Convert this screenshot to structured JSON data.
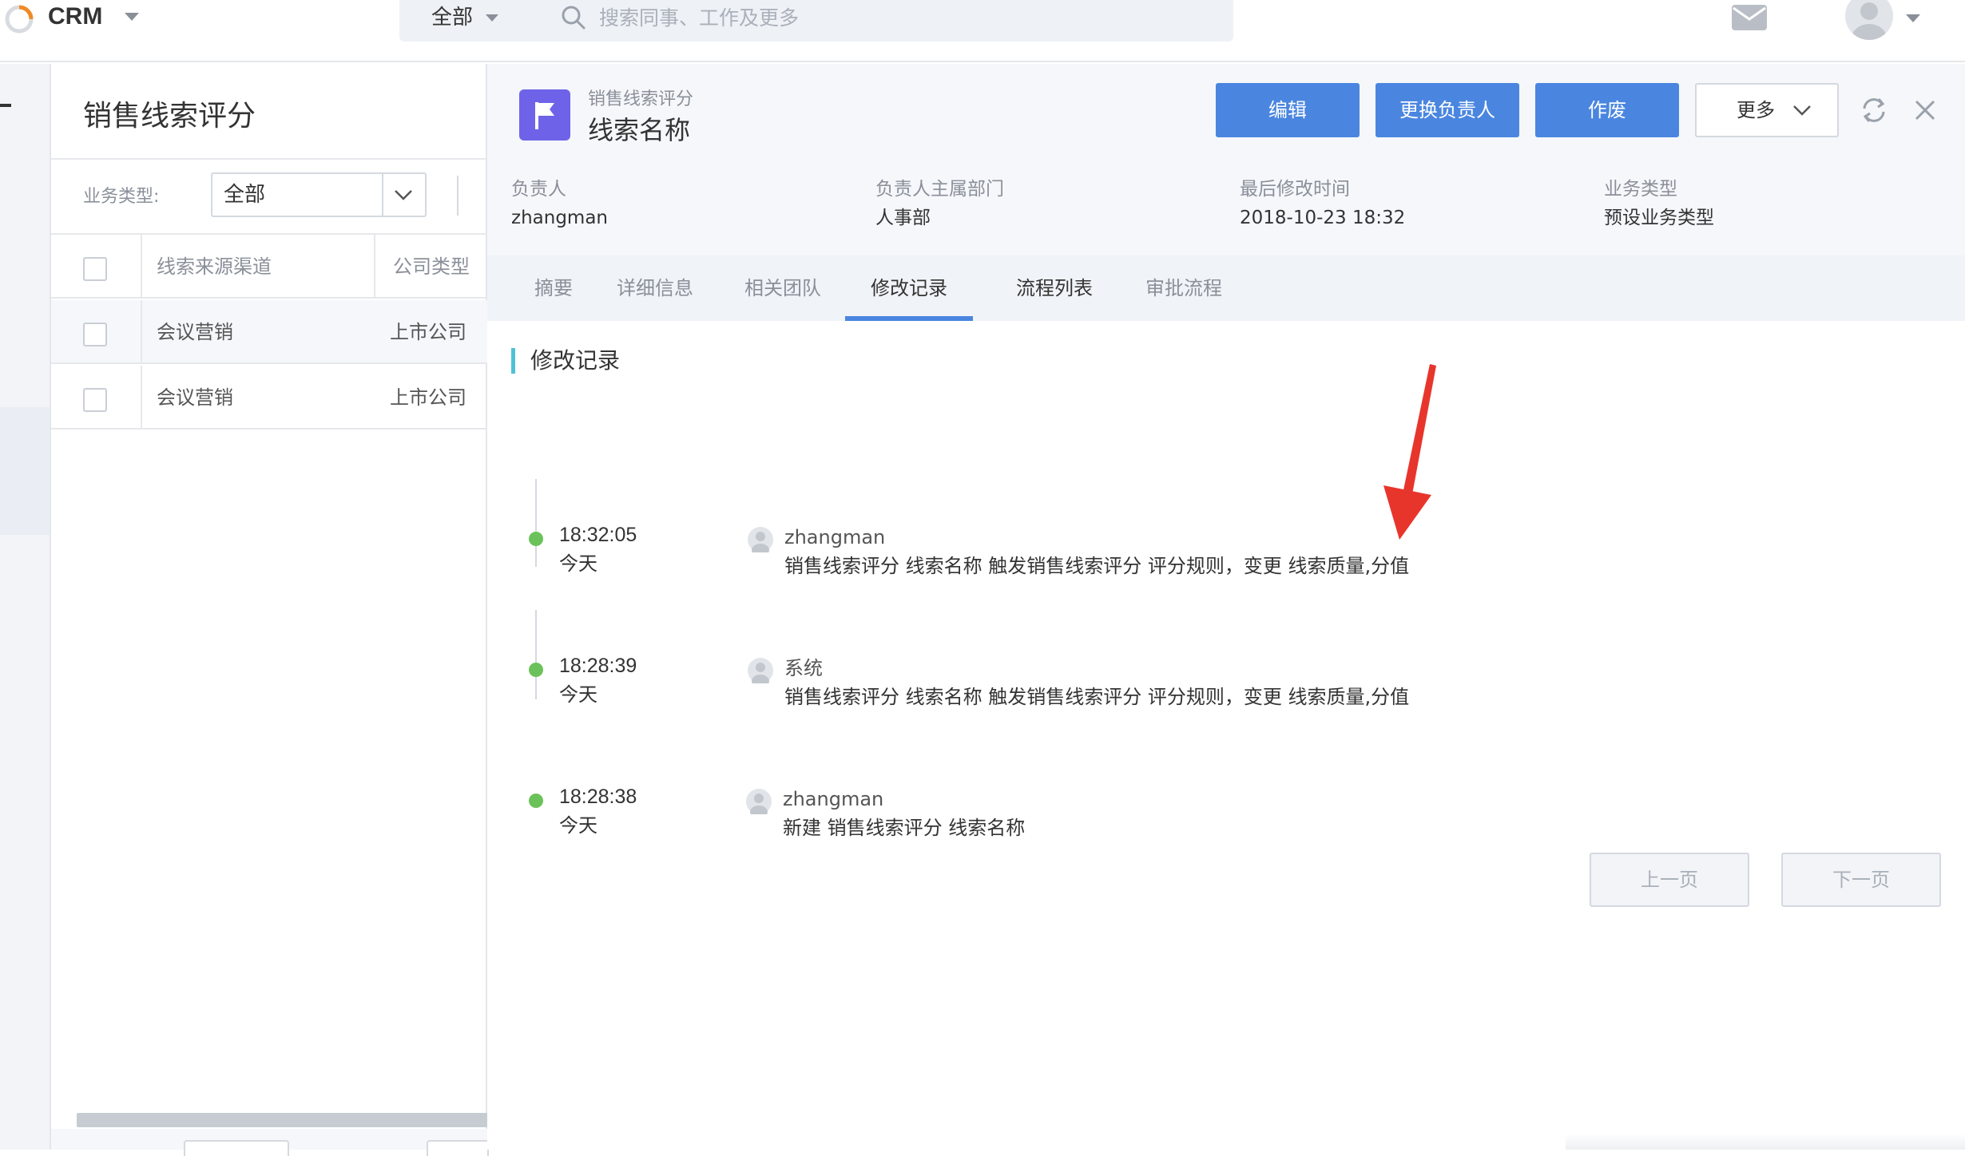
{
  "app": {
    "brand": "CRM"
  },
  "search": {
    "scope": "全部",
    "placeholder": "搜索同事、工作及更多"
  },
  "list": {
    "title": "销售线索评分",
    "filter_label": "业务类型:",
    "filter_value": "全部",
    "columns": [
      "线索来源渠道",
      "公司类型"
    ],
    "rows": [
      {
        "channel": "会议营销",
        "company_type": "上市公司"
      },
      {
        "channel": "会议营销",
        "company_type": "上市公司"
      }
    ]
  },
  "detail": {
    "object_type": "销售线索评分",
    "object_name": "线索名称",
    "buttons": {
      "edit": "编辑",
      "change_owner": "更换负责人",
      "void": "作废",
      "more": "更多"
    },
    "meta": [
      {
        "label": "负责人",
        "value": "zhangman"
      },
      {
        "label": "负责人主属部门",
        "value": "人事部"
      },
      {
        "label": "最后修改时间",
        "value": "2018-10-23 18:32"
      },
      {
        "label": "业务类型",
        "value": "预设业务类型"
      }
    ],
    "tabs": [
      "摘要",
      "详细信息",
      "相关团队",
      "修改记录",
      "流程列表",
      "审批流程"
    ],
    "active_tab": "修改记录",
    "section_title": "修改记录",
    "entries": [
      {
        "time": "18:32:05",
        "day": "今天",
        "user": "zhangman",
        "text": "销售线索评分 线索名称 触发销售线索评分 评分规则，变更 线索质量,分值"
      },
      {
        "time": "18:28:39",
        "day": "今天",
        "user": "系统",
        "text": "销售线索评分 线索名称 触发销售线索评分 评分规则，变更 线索质量,分值"
      },
      {
        "time": "18:28:38",
        "day": "今天",
        "user": "zhangman",
        "text": "新建 销售线索评分 线索名称"
      }
    ],
    "pager": {
      "prev": "上一页",
      "next": "下一页"
    }
  },
  "colors": {
    "primary": "#4a86e0",
    "flag": "#6e63e8",
    "timeline_dot": "#6cc25a",
    "arrow": "#e8352c",
    "section_accent": "#4fc1d6"
  },
  "icons": [
    "logo-icon",
    "search-icon",
    "mail-icon",
    "avatar-icon",
    "flag-icon",
    "refresh-icon",
    "close-icon",
    "chevron-down-icon",
    "annotation-arrow"
  ]
}
